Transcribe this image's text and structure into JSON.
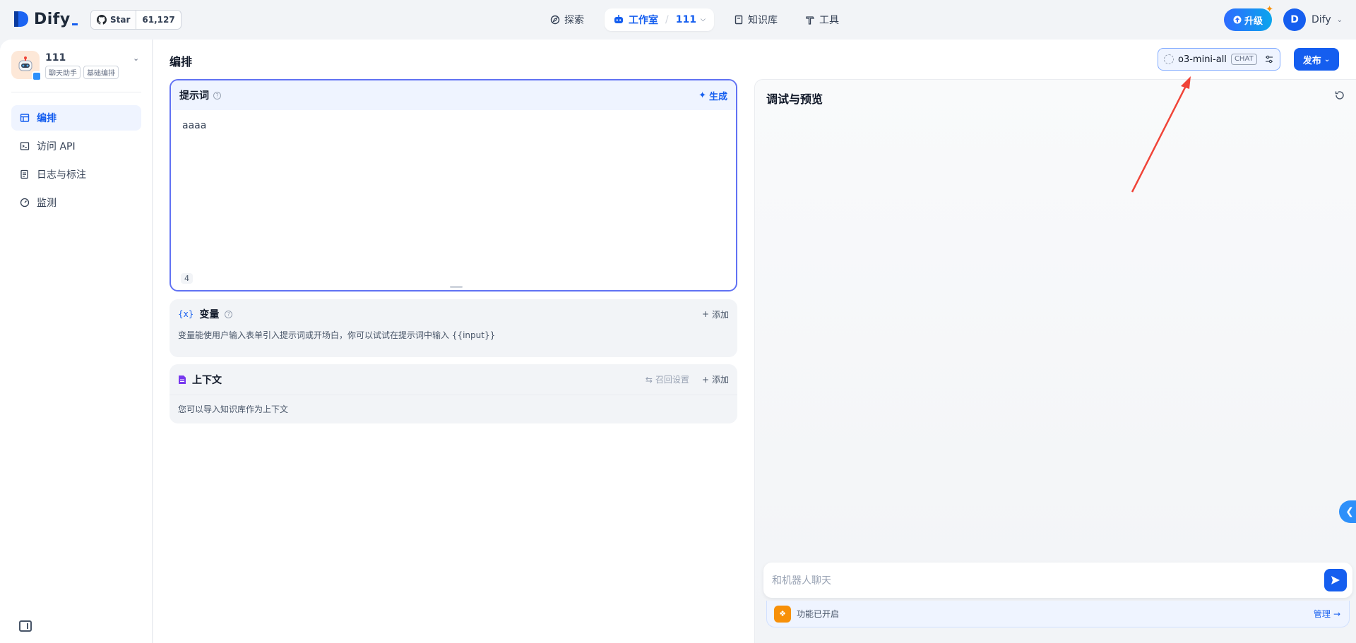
{
  "header": {
    "logo_text": "Dify",
    "github": {
      "star_label": "Star",
      "star_count": "61,127"
    },
    "nav": {
      "explore": "探索",
      "studio": "工作室",
      "separator": "/",
      "current_app": "111",
      "knowledge": "知识库",
      "tools": "工具"
    },
    "upgrade_label": "升级",
    "user": {
      "initial": "D",
      "name": "Dify"
    }
  },
  "sidebar": {
    "app": {
      "name": "111",
      "tags": [
        "聊天助手",
        "基础编排"
      ]
    },
    "items": [
      {
        "label": "编排",
        "icon": "layout-icon",
        "active": true
      },
      {
        "label": "访问 API",
        "icon": "terminal-icon",
        "active": false
      },
      {
        "label": "日志与标注",
        "icon": "file-list-icon",
        "active": false
      },
      {
        "label": "监测",
        "icon": "dashboard-icon",
        "active": false
      }
    ]
  },
  "main": {
    "title": "编排",
    "model": {
      "name": "o3-mini-all",
      "mode_tag": "CHAT"
    },
    "publish_label": "发布"
  },
  "prompt": {
    "label": "提示词",
    "help": "?",
    "generate_label": "生成",
    "text": "aaaa",
    "char_count": "4"
  },
  "variables": {
    "title": "变量",
    "help": "?",
    "add_label": "添加",
    "description": "变量能使用户输入表单引入提示词或开场白，你可以试试在提示词中输入 {{input}}"
  },
  "context": {
    "title": "上下文",
    "recall_settings_label": "召回设置",
    "add_label": "添加",
    "description": "您可以导入知识库作为上下文"
  },
  "debug": {
    "title": "调试与预览",
    "input_placeholder": "和机器人聊天",
    "features_label": "功能已开启",
    "manage_label": "管理"
  },
  "colors": {
    "accent": "#155eef",
    "prompt_border": "#6172f3",
    "arrow": "#f04438"
  }
}
